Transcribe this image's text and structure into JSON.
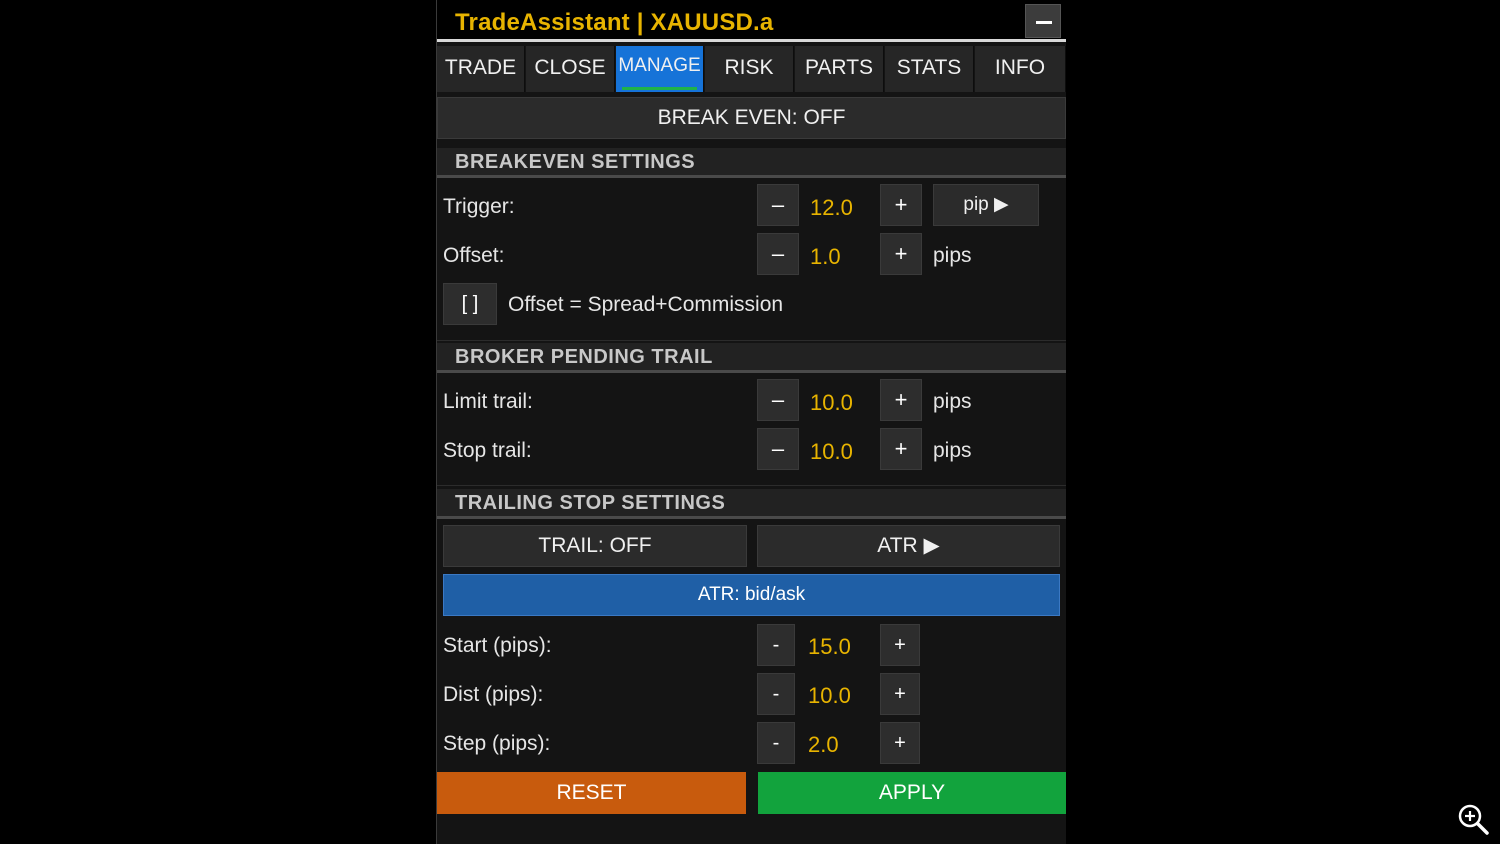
{
  "title": "TradeAssistant  |  XAUUSD.a",
  "tabs": [
    "TRADE",
    "CLOSE",
    "MANAGE",
    "RISK",
    "PARTS",
    "STATS",
    "INFO"
  ],
  "active_tab": "MANAGE",
  "break_even_button": "BREAK EVEN: OFF",
  "breakeven": {
    "heading": "BREAKEVEN SETTINGS",
    "trigger_label": "Trigger:",
    "trigger_value": "12.0",
    "trigger_unit_button": "pip ▶",
    "offset_label": "Offset:",
    "offset_value": "1.0",
    "offset_unit": "pips",
    "checkbox_label": "[ ]",
    "checkbox_text": "Offset = Spread+Commission"
  },
  "broker_trail": {
    "heading": "BROKER PENDING TRAIL",
    "limit_label": "Limit trail:",
    "limit_value": "10.0",
    "limit_unit": "pips",
    "stop_label": "Stop trail:",
    "stop_value": "10.0",
    "stop_unit": "pips"
  },
  "trailing": {
    "heading": "TRAILING STOP SETTINGS",
    "trail_button": "TRAIL: OFF",
    "mode_button": "ATR ▶",
    "atr_bar": "ATR: bid/ask",
    "start_label": "Start (pips):",
    "start_value": "15.0",
    "dist_label": "Dist (pips):",
    "dist_value": "10.0",
    "step_label": "Step (pips):",
    "step_value": "2.0"
  },
  "symbols": {
    "minus": "–",
    "plus": "+",
    "dash": "-"
  },
  "reset_button": "RESET",
  "apply_button": "APPLY",
  "icons": {
    "minimize": "minimize-icon",
    "zoom": "zoom-in-icon"
  },
  "colors": {
    "accent_yellow": "#e8b400",
    "active_tab": "#1673d8",
    "reset": "#c85b0d",
    "apply": "#12a33d",
    "atr_bar": "#1f5fa6"
  }
}
